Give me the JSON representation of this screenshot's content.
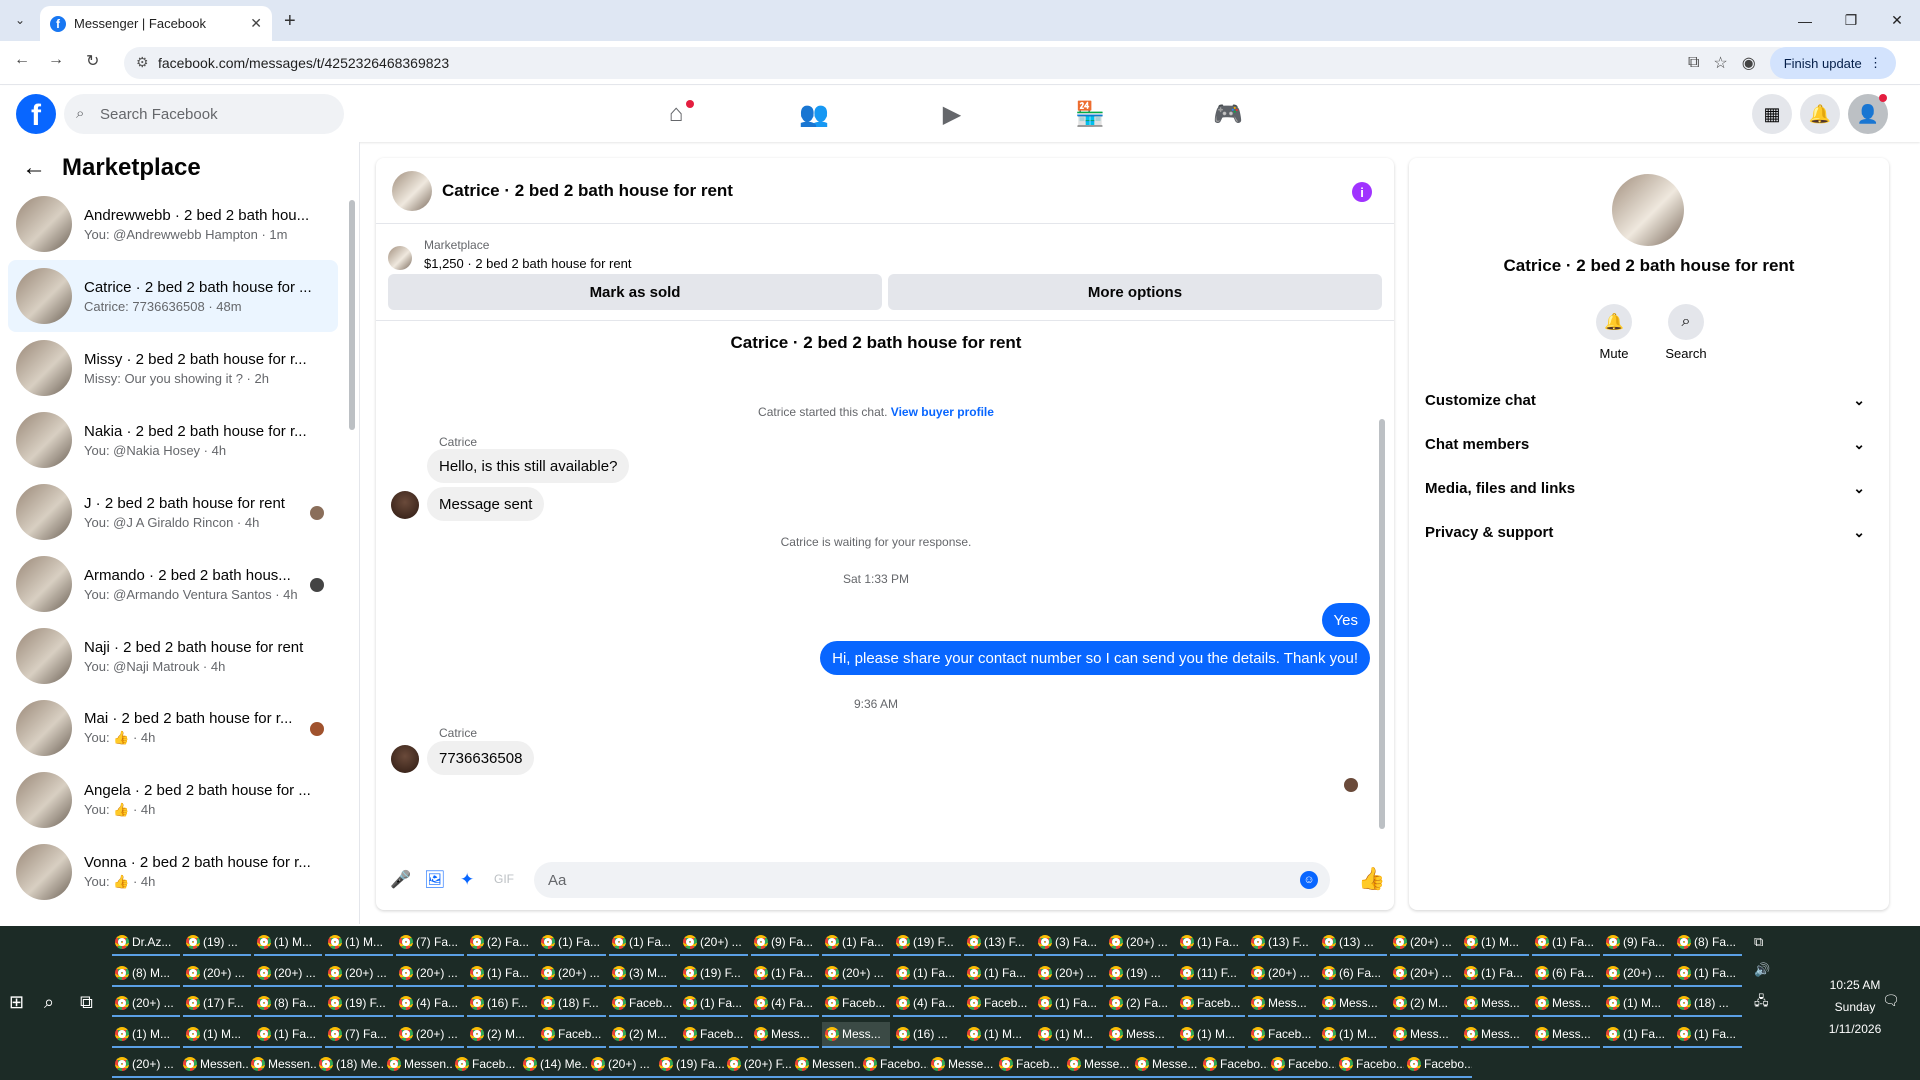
{
  "browser": {
    "tab_title": "Messenger | Facebook",
    "url": "facebook.com/messages/t/4252326468369823",
    "finish_update": "Finish update"
  },
  "fbnav": {
    "search_placeholder": "Search Facebook",
    "icons": [
      "home-icon",
      "friends-icon",
      "video-icon",
      "marketplace-icon",
      "gaming-icon"
    ],
    "right_icons": [
      "menu-grid-icon",
      "notifications-bell-icon",
      "account-avatar"
    ]
  },
  "left": {
    "title": "Marketplace",
    "conversations": [
      {
        "name": "Andrewwebb · 2 bed 2 bath hou...",
        "preview": "You: @Andrewwebb Hampton · 1m"
      },
      {
        "name": "Catrice · 2 bed 2 bath house for ...",
        "preview": "Catrice: 7736636508 · 48m"
      },
      {
        "name": "Missy · 2 bed 2 bath house for r...",
        "preview": "Missy: Our you showing it ? · 2h"
      },
      {
        "name": "Nakia · 2 bed 2 bath house for r...",
        "preview": "You: @Nakia Hosey · 4h"
      },
      {
        "name": "J · 2 bed 2 bath house for rent",
        "preview": "You: @J A Giraldo Rincon · 4h"
      },
      {
        "name": "Armando · 2 bed 2 bath hous...",
        "preview": "You: @Armando Ventura Santos · 4h"
      },
      {
        "name": "Naji · 2 bed 2 bath house for rent",
        "preview": "You: @Naji Matrouk · 4h"
      },
      {
        "name": "Mai · 2 bed 2 bath house for r...",
        "preview": "You: 👍 · 4h"
      },
      {
        "name": "Angela · 2 bed 2 bath house for ...",
        "preview": "You: 👍 · 4h"
      },
      {
        "name": "Vonna · 2 bed 2 bath house for r...",
        "preview": "You: 👍 · 4h"
      }
    ]
  },
  "chat": {
    "header_title": "Catrice · 2 bed 2 bath house for rent",
    "listing_label": "Marketplace",
    "listing_detail": "$1,250 · 2 bed 2 bath house for rent",
    "mark_sold": "Mark as sold",
    "more_options": "More options",
    "intro_title": "Catrice · 2 bed 2 bath house for rent",
    "started_text": "Catrice started this chat.",
    "view_profile": "View buyer profile",
    "sender1": "Catrice",
    "msg1": "Hello, is this still available?",
    "msg2": "Message sent",
    "waiting": "Catrice is waiting for your response.",
    "time1": "Sat 1:33 PM",
    "out1": "Yes",
    "out2": "Hi, please share your contact number so I can send you the details. Thank you!",
    "time2": "9:36 AM",
    "sender2": "Catrice",
    "msg3": "7736636508",
    "composer_placeholder": "Aa"
  },
  "right": {
    "name": "Catrice · 2 bed 2 bath house for rent",
    "mute": "Mute",
    "search": "Search",
    "sections": [
      "Customize chat",
      "Chat members",
      "Media, files and links",
      "Privacy & support"
    ]
  },
  "taskbar": {
    "rows": [
      [
        "Dr.Az...",
        "(19) ...",
        "(1) M...",
        "(1) M...",
        "(7) Fa...",
        "(2) Fa...",
        "(1) Fa...",
        "(1) Fa...",
        "(20+) ...",
        "(9) Fa...",
        "(1) Fa...",
        "(19) F...",
        "(13) F...",
        "(3) Fa...",
        "(20+) ...",
        "(1) Fa...",
        "(13) F...",
        "(13) ...",
        "(20+) ...",
        "(1) M...",
        "(1) Fa...",
        "(9) Fa...",
        "(8) Fa..."
      ],
      [
        "(8) M...",
        "(20+) ...",
        "(20+) ...",
        "(20+) ...",
        "(20+) ...",
        "(1) Fa...",
        "(20+) ...",
        "(3) M...",
        "(19) F...",
        "(1) Fa...",
        "(20+) ...",
        "(1) Fa...",
        "(1) Fa...",
        "(20+) ...",
        "(19) ...",
        "(11) F...",
        "(20+) ...",
        "(6) Fa...",
        "(20+) ...",
        "(1) Fa...",
        "(6) Fa...",
        "(20+) ...",
        "(1) Fa..."
      ],
      [
        "(20+) ...",
        "(17) F...",
        "(8) Fa...",
        "(19) F...",
        "(4) Fa...",
        "(16) F...",
        "(18) F...",
        "Faceb...",
        "(1) Fa...",
        "(4) Fa...",
        "Faceb...",
        "(4) Fa...",
        "Faceb...",
        "(1) Fa...",
        "(2) Fa...",
        "Faceb...",
        "Mess...",
        "Mess...",
        "(2) M...",
        "Mess...",
        "Mess...",
        "(1) M...",
        "(18) ..."
      ],
      [
        "(1) M...",
        "(1) M...",
        "(1) Fa...",
        "(7) Fa...",
        "(20+) ...",
        "(2) M...",
        "Faceb...",
        "(2) M...",
        "Faceb...",
        "Mess...",
        "Mess...",
        "(16) ...",
        "(1) M...",
        "(1) M...",
        "Mess...",
        "(1) M...",
        "Faceb...",
        "(1) M...",
        "Mess...",
        "Mess...",
        "Mess...",
        "(1) Fa...",
        "(1) Fa..."
      ],
      [
        "(20+) ...",
        "Messen...",
        "Messen...",
        "(18) Me...",
        "Messen...",
        "Faceb...",
        "(14) Me...",
        "(20+) ...",
        "(19) Fa...",
        "(20+) F...",
        "Messen...",
        "Facebo...",
        "Messe...",
        "Faceb...",
        "Messe...",
        "Messe...",
        "Facebo...",
        "Facebo...",
        "Facebo...",
        "Facebo..."
      ]
    ],
    "time": "10:25 AM",
    "day": "Sunday",
    "date": "1/11/2026"
  }
}
